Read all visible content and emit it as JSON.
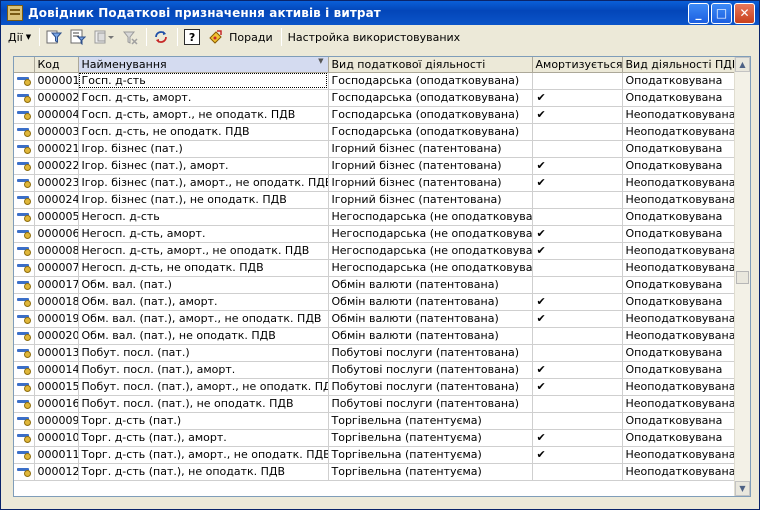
{
  "window": {
    "title": "Довідник Податкові призначення активів і витрат"
  },
  "toolbar": {
    "actions_label": "Дії",
    "tips_label": "Поради",
    "settings_label": "Настройка використовуваних",
    "help_glyph": "?"
  },
  "table": {
    "columns": [
      "Код",
      "Найменування",
      "Вид податкової діяльності",
      "Амортизується",
      "Вид діяльності ПДВ"
    ],
    "rows": [
      {
        "code": "000001",
        "name": "Госп. д-сть",
        "activity": "Господарська (оподатковувана)",
        "amort": "",
        "vat": "Оподатковувана"
      },
      {
        "code": "000002",
        "name": "Госп. д-сть, аморт.",
        "activity": "Господарська (оподатковувана)",
        "amort": "✔",
        "vat": "Оподатковувана"
      },
      {
        "code": "000004",
        "name": "Госп. д-сть, аморт., не оподатк. ПДВ",
        "activity": "Господарська (оподатковувана)",
        "amort": "✔",
        "vat": "Неоподатковувана"
      },
      {
        "code": "000003",
        "name": "Госп. д-сть, не оподатк. ПДВ",
        "activity": "Господарська (оподатковувана)",
        "amort": "",
        "vat": "Неоподатковувана"
      },
      {
        "code": "000021",
        "name": "Ігор. бізнес (пат.)",
        "activity": "Ігорний бізнес (патентована)",
        "amort": "",
        "vat": "Оподатковувана"
      },
      {
        "code": "000022",
        "name": "Ігор. бізнес (пат.), аморт.",
        "activity": "Ігорний бізнес (патентована)",
        "amort": "✔",
        "vat": "Оподатковувана"
      },
      {
        "code": "000023",
        "name": "Ігор. бізнес (пат.), аморт., не оподатк. ПДВ",
        "activity": "Ігорний бізнес (патентована)",
        "amort": "✔",
        "vat": "Неоподатковувана"
      },
      {
        "code": "000024",
        "name": "Ігор. бізнес (пат.), не оподатк. ПДВ",
        "activity": "Ігорний бізнес (патентована)",
        "amort": "",
        "vat": "Неоподатковувана"
      },
      {
        "code": "000005",
        "name": "Негосп. д-сть",
        "activity": "Негосподарська (не оподатковувана)",
        "amort": "",
        "vat": "Оподатковувана"
      },
      {
        "code": "000006",
        "name": "Негосп. д-сть, аморт.",
        "activity": "Негосподарська (не оподатковувана)",
        "amort": "✔",
        "vat": "Оподатковувана"
      },
      {
        "code": "000008",
        "name": "Негосп. д-сть, аморт., не оподатк. ПДВ",
        "activity": "Негосподарська (не оподатковувана)",
        "amort": "✔",
        "vat": "Неоподатковувана"
      },
      {
        "code": "000007",
        "name": "Негосп. д-сть, не оподатк. ПДВ",
        "activity": "Негосподарська (не оподатковувана)",
        "amort": "",
        "vat": "Неоподатковувана"
      },
      {
        "code": "000017",
        "name": "Обм. вал. (пат.)",
        "activity": "Обмін валюти (патентована)",
        "amort": "",
        "vat": "Оподатковувана"
      },
      {
        "code": "000018",
        "name": "Обм. вал. (пат.), аморт.",
        "activity": "Обмін валюти (патентована)",
        "amort": "✔",
        "vat": "Оподатковувана"
      },
      {
        "code": "000019",
        "name": "Обм. вал. (пат.), аморт., не оподатк. ПДВ",
        "activity": "Обмін валюти (патентована)",
        "amort": "✔",
        "vat": "Неоподатковувана"
      },
      {
        "code": "000020",
        "name": "Обм. вал. (пат.), не оподатк. ПДВ",
        "activity": "Обмін валюти (патентована)",
        "amort": "",
        "vat": "Неоподатковувана"
      },
      {
        "code": "000013",
        "name": "Побут. посл. (пат.)",
        "activity": "Побутові послуги (патентована)",
        "amort": "",
        "vat": "Оподатковувана"
      },
      {
        "code": "000014",
        "name": "Побут. посл. (пат.), аморт.",
        "activity": "Побутові послуги (патентована)",
        "amort": "✔",
        "vat": "Оподатковувана"
      },
      {
        "code": "000015",
        "name": "Побут. посл. (пат.), аморт., не оподатк. ПДВ",
        "activity": "Побутові послуги (патентована)",
        "amort": "✔",
        "vat": "Неоподатковувана"
      },
      {
        "code": "000016",
        "name": "Побут. посл. (пат.), не оподатк. ПДВ",
        "activity": "Побутові послуги (патентована)",
        "amort": "",
        "vat": "Неоподатковувана"
      },
      {
        "code": "000009",
        "name": "Торг. д-сть (пат.)",
        "activity": "Торгівельна (патентуєма)",
        "amort": "",
        "vat": "Оподатковувана"
      },
      {
        "code": "000010",
        "name": "Торг. д-сть (пат.), аморт.",
        "activity": "Торгівельна (патентуєма)",
        "amort": "✔",
        "vat": "Оподатковувана"
      },
      {
        "code": "000011",
        "name": "Торг. д-сть (пат.), аморт., не оподатк. ПДВ",
        "activity": "Торгівельна (патентуєма)",
        "amort": "✔",
        "vat": "Неоподатковувана"
      },
      {
        "code": "000012",
        "name": "Торг. д-сть (пат.), не оподатк. ПДВ",
        "activity": "Торгівельна (патентуєма)",
        "amort": "",
        "vat": "Неоподатковувана"
      }
    ]
  }
}
